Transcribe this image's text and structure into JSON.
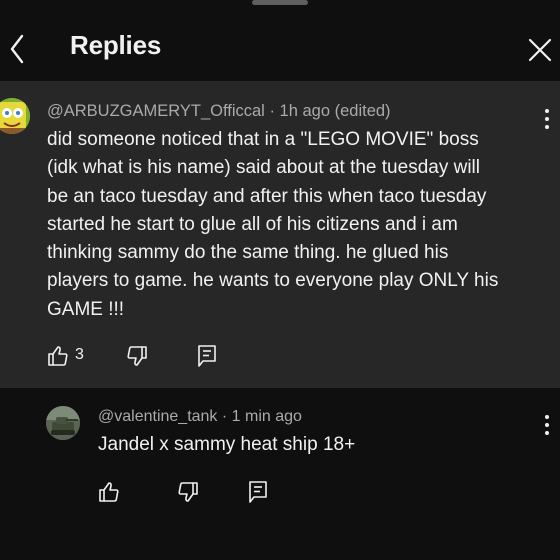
{
  "header": {
    "title": "Replies",
    "back_icon": "chevron-left-icon",
    "close_icon": "close-icon"
  },
  "parent_comment": {
    "author": "@ARBUZGAMERYT_Officcal",
    "separator": "·",
    "timestamp": "1h ago (edited)",
    "body_lines": [
      "did someone noticed that in a \"LEGO MOVIE\"  boss",
      "(idk what is his name) said about at the tuesday will",
      "be an taco tuesday and after this when taco tuesday",
      "started he start to glue all of his citizens and i am",
      "thinking sammy do the same thing. he glued his",
      "players to game. he wants to everyone play ONLY his",
      "GAME !!!"
    ],
    "like_count": "3"
  },
  "reply": {
    "author": "@valentine_tank",
    "separator": "·",
    "timestamp": "1 min ago",
    "body": "Jandel x sammy heat ship 18+"
  },
  "colors": {
    "background": "#0f0f0f",
    "highlight_background": "#272727",
    "text_primary": "#f1f1f1",
    "text_secondary": "#aaaaaa"
  }
}
